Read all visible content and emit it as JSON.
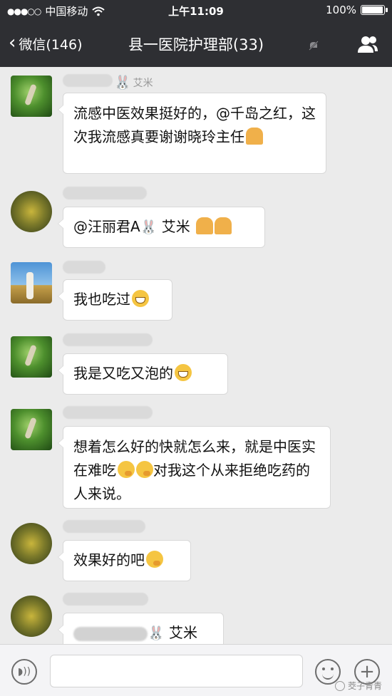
{
  "status_bar": {
    "carrier": "中国移动",
    "time": "上午11:09",
    "battery_percent_text": "100%",
    "battery_level": 1.0
  },
  "nav": {
    "back_label": "微信(146)",
    "title": "县一医院护理部(33)"
  },
  "messages": [
    {
      "sender_suffix": "艾米",
      "text": "流感中医效果挺好的，@千岛之红，这次我流感真要谢谢晓玲主任"
    },
    {
      "text": "@汪丽君A",
      "text_suffix": "艾米"
    },
    {
      "text": "我也吃过"
    },
    {
      "text": "我是又吃又泡的"
    },
    {
      "text": "想着怎么好的快就怎么来，就是中医实在难吃",
      "text_after": "对我这个从来拒绝吃药的人来说。"
    },
    {
      "text": "效果好的吧"
    },
    {
      "text_suffix": "艾米"
    }
  ],
  "watermark": "茭子青青",
  "icons": {
    "wifi": "wifi-icon",
    "back": "chevron-left-icon",
    "mute": "mute-bell-icon",
    "group": "people-icon",
    "voice": "voice-icon",
    "emoji": "emoji-icon",
    "plus": "plus-icon"
  }
}
